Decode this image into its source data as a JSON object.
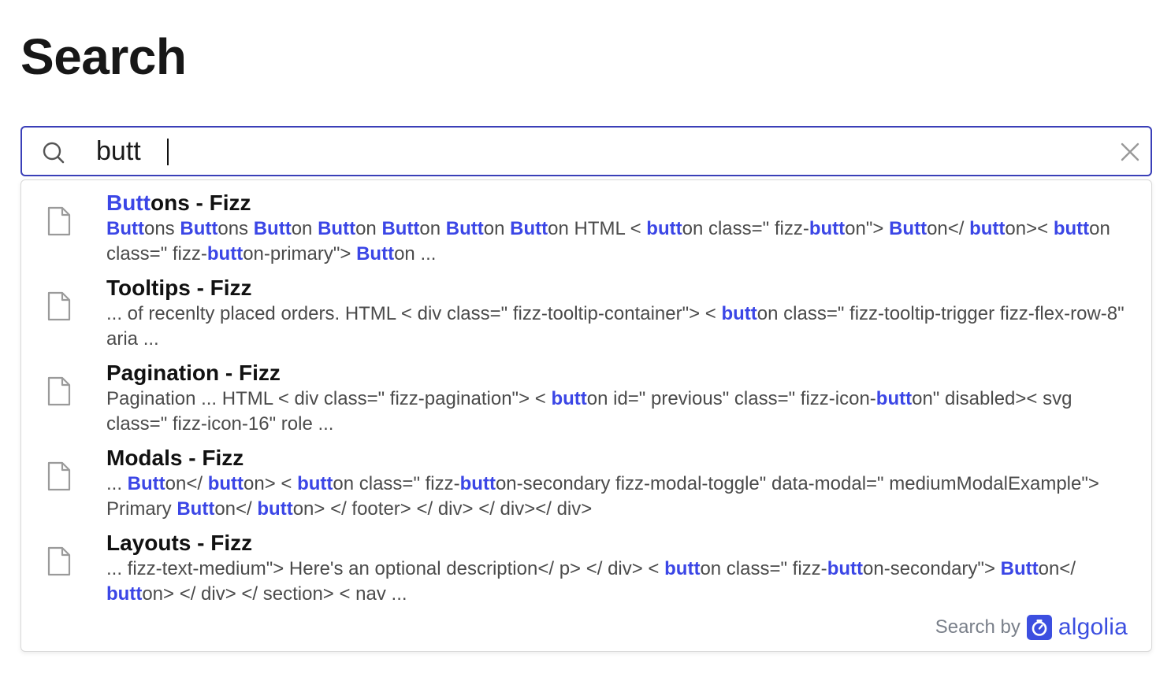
{
  "page": {
    "title": "Search"
  },
  "search": {
    "value": "butt",
    "placeholder": ""
  },
  "colors": {
    "accent": "#3b46e6",
    "border": "#3a3fb8",
    "algolia": "#3c4fe0"
  },
  "results": [
    {
      "title_parts": [
        {
          "t": "Butt",
          "h": true
        },
        {
          "t": "ons - Fizz",
          "h": false
        }
      ],
      "snippet_parts": [
        {
          "t": "Butt",
          "h": true
        },
        {
          "t": "ons ",
          "h": false
        },
        {
          "t": "Butt",
          "h": true
        },
        {
          "t": "ons ",
          "h": false
        },
        {
          "t": "Butt",
          "h": true
        },
        {
          "t": "on ",
          "h": false
        },
        {
          "t": "Butt",
          "h": true
        },
        {
          "t": "on ",
          "h": false
        },
        {
          "t": "Butt",
          "h": true
        },
        {
          "t": "on ",
          "h": false
        },
        {
          "t": "Butt",
          "h": true
        },
        {
          "t": "on ",
          "h": false
        },
        {
          "t": "Butt",
          "h": true
        },
        {
          "t": "on HTML < ",
          "h": false
        },
        {
          "t": "butt",
          "h": true
        },
        {
          "t": "on class=\" fizz-",
          "h": false
        },
        {
          "t": "butt",
          "h": true
        },
        {
          "t": "on\"> ",
          "h": false
        },
        {
          "t": "Butt",
          "h": true
        },
        {
          "t": "on</ ",
          "h": false
        },
        {
          "t": "butt",
          "h": true
        },
        {
          "t": "on>< ",
          "h": false
        },
        {
          "t": "butt",
          "h": true
        },
        {
          "t": "on class=\" fizz-",
          "h": false
        },
        {
          "t": "butt",
          "h": true
        },
        {
          "t": "on-primary\"> ",
          "h": false
        },
        {
          "t": "Butt",
          "h": true
        },
        {
          "t": "on ...",
          "h": false
        }
      ]
    },
    {
      "title_parts": [
        {
          "t": "Tooltips - Fizz",
          "h": false
        }
      ],
      "snippet_parts": [
        {
          "t": "... of recenlty placed orders. HTML < div class=\" fizz-tooltip-container\"> < ",
          "h": false
        },
        {
          "t": "butt",
          "h": true
        },
        {
          "t": "on class=\" fizz-tooltip-trigger fizz-flex-row-8\" aria ...",
          "h": false
        }
      ]
    },
    {
      "title_parts": [
        {
          "t": "Pagination - Fizz",
          "h": false
        }
      ],
      "snippet_parts": [
        {
          "t": "Pagination ... HTML < div class=\" fizz-pagination\"> < ",
          "h": false
        },
        {
          "t": "butt",
          "h": true
        },
        {
          "t": "on id=\" previous\" class=\" fizz-icon-",
          "h": false
        },
        {
          "t": "butt",
          "h": true
        },
        {
          "t": "on\" disabled>< svg class=\" fizz-icon-16\" role ...",
          "h": false
        }
      ]
    },
    {
      "title_parts": [
        {
          "t": "Modals - Fizz",
          "h": false
        }
      ],
      "snippet_parts": [
        {
          "t": "... ",
          "h": false
        },
        {
          "t": "Butt",
          "h": true
        },
        {
          "t": "on</ ",
          "h": false
        },
        {
          "t": "butt",
          "h": true
        },
        {
          "t": "on> < ",
          "h": false
        },
        {
          "t": "butt",
          "h": true
        },
        {
          "t": "on class=\" fizz-",
          "h": false
        },
        {
          "t": "butt",
          "h": true
        },
        {
          "t": "on-secondary fizz-modal-toggle\" data-modal=\" mediumModalExample\"> Primary ",
          "h": false
        },
        {
          "t": "Butt",
          "h": true
        },
        {
          "t": "on</ ",
          "h": false
        },
        {
          "t": "butt",
          "h": true
        },
        {
          "t": "on> </ footer> </ div> </ div></ div>",
          "h": false
        }
      ]
    },
    {
      "title_parts": [
        {
          "t": "Layouts - Fizz",
          "h": false
        }
      ],
      "snippet_parts": [
        {
          "t": "... fizz-text-medium\"> Here's an optional description</ p> </ div> < ",
          "h": false
        },
        {
          "t": "butt",
          "h": true
        },
        {
          "t": "on class=\" fizz-",
          "h": false
        },
        {
          "t": "butt",
          "h": true
        },
        {
          "t": "on-secondary\"> ",
          "h": false
        },
        {
          "t": "Butt",
          "h": true
        },
        {
          "t": "on</ ",
          "h": false
        },
        {
          "t": "butt",
          "h": true
        },
        {
          "t": "on> </ div> </ section> < nav ...",
          "h": false
        }
      ]
    }
  ],
  "footer": {
    "powered_label": "Search by",
    "brand": "algolia",
    "brand_icon": "algolia-logo-icon"
  }
}
